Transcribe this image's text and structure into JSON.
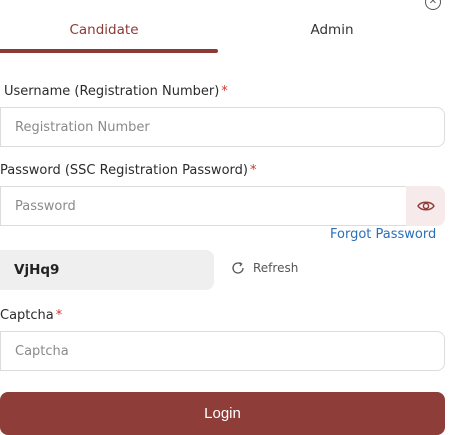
{
  "tabs": {
    "candidate": "Candidate",
    "admin": "Admin"
  },
  "form": {
    "username_label": "Username (Registration Number)",
    "username_placeholder": "Registration Number",
    "password_label": "Password (SSC Registration Password)",
    "password_placeholder": "Password",
    "required_marker": "*",
    "forgot_password": "Forgot Password",
    "captcha_value": "VjHq9",
    "refresh_label": "Refresh",
    "captcha_label": "Captcha",
    "captcha_placeholder": "Captcha",
    "login_label": "Login"
  },
  "icons": {
    "close": "close-icon",
    "eye": "eye-icon",
    "refresh": "refresh-icon"
  },
  "colors": {
    "accent": "#8b3a36",
    "button": "#8e3d38",
    "link": "#2a6fb8",
    "required": "#d0342c",
    "eye_bg": "#f6eaea"
  }
}
